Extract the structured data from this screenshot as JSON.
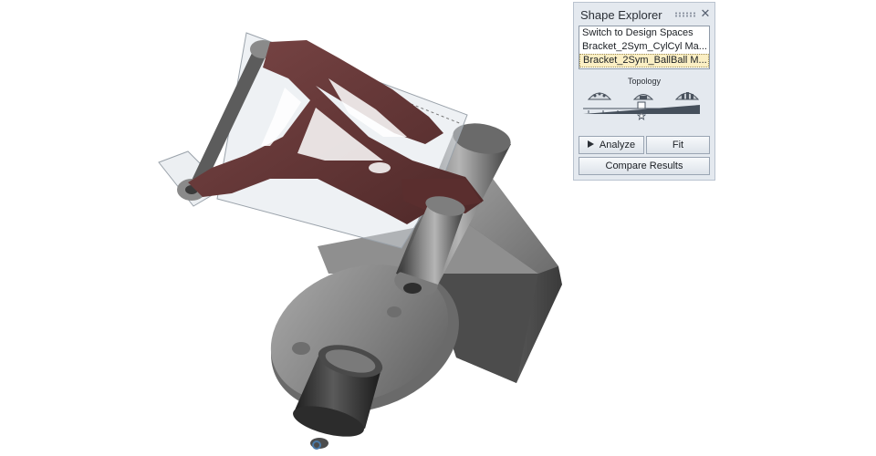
{
  "panel": {
    "title": "Shape Explorer",
    "design_spaces": [
      {
        "label": "Switch to Design Spaces",
        "selected": false
      },
      {
        "label": "Bracket_2Sym_CylCyl Ma...",
        "selected": false
      },
      {
        "label": "Bracket_2Sym_BallBall M...",
        "selected": true
      }
    ],
    "topology_label": "Topology",
    "topology_level": 0.5,
    "analyze_label": "Analyze",
    "fit_label": "Fit",
    "compare_label": "Compare Results",
    "icons": {
      "close": "close-icon",
      "analyze": "play-icon",
      "slider_thumb": "star-icon"
    }
  },
  "colors": {
    "bracket": "#6a3a3a",
    "panel_bg": "#e4e9ef",
    "selection": "#fbefc4",
    "slider_accent": "#46505c"
  }
}
